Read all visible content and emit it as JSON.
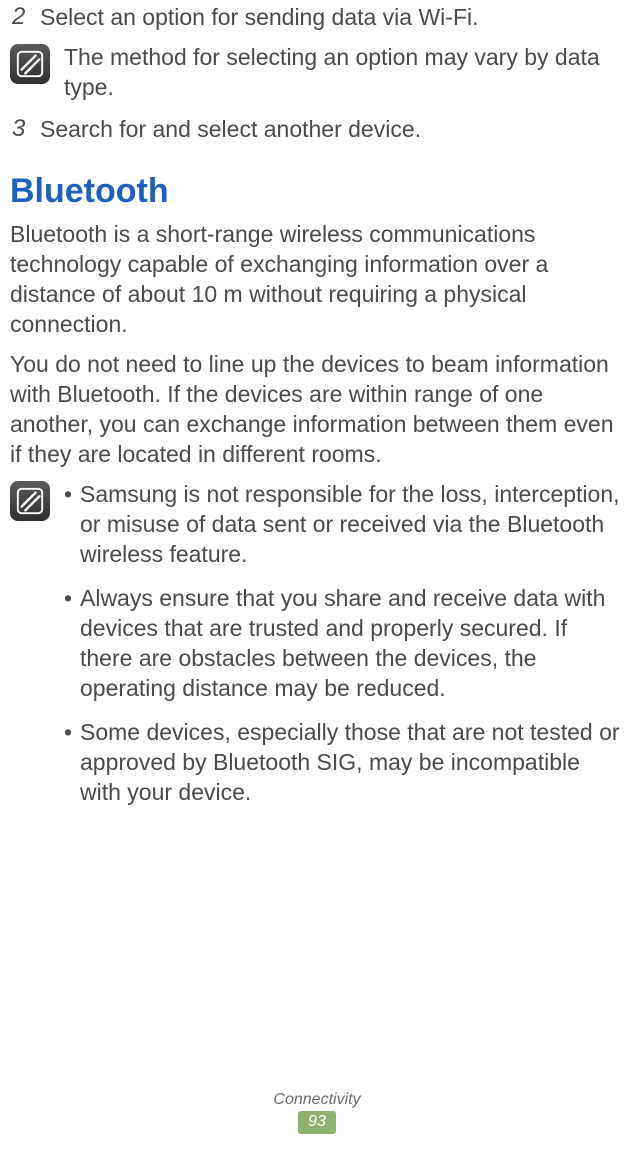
{
  "steps": {
    "s2": {
      "num": "2",
      "text": "Select an option for sending data via Wi-Fi."
    },
    "s2_note": "The method for selecting an option may vary by data type.",
    "s3": {
      "num": "3",
      "text": "Search for and select another device."
    }
  },
  "heading": "Bluetooth",
  "para1": "Bluetooth is a short-range wireless communications technology capable of exchanging information over a distance of about 10 m without requiring a physical connection.",
  "para2": "You do not need to line up the devices to beam information with Bluetooth. If the devices are within range of one another, you can exchange information between them even if they are located in different rooms.",
  "bullets": {
    "b1": "Samsung is not responsible for the loss, interception, or misuse of data sent or received via the Bluetooth wireless feature.",
    "b2": "Always ensure that you share and receive data with devices that are trusted and properly secured. If there are obstacles between the devices, the operating distance may be reduced.",
    "b3": "Some devices, especially those that are not tested or approved by Bluetooth SIG, may be incompatible with your device."
  },
  "footer": {
    "section": "Connectivity",
    "page": "93"
  }
}
